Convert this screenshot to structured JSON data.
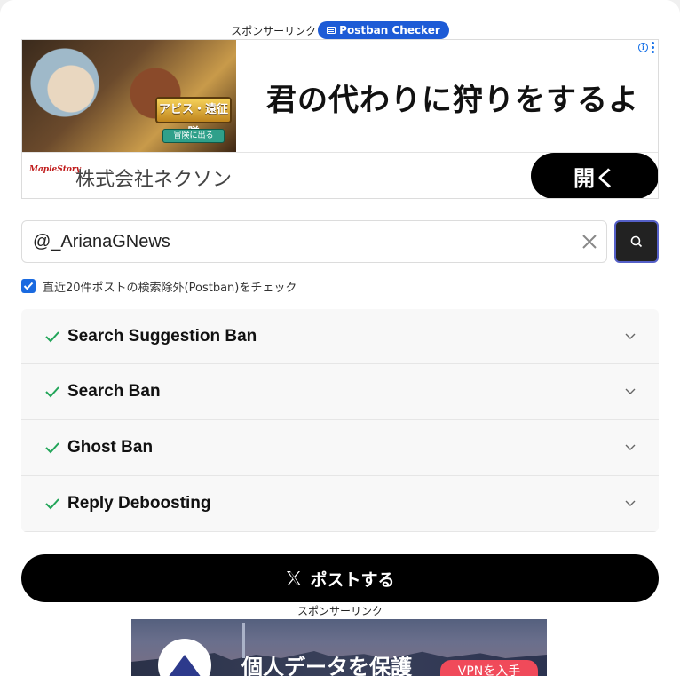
{
  "top_sponsor": {
    "label": "スポンサーリンク",
    "badge": "Postban Checker"
  },
  "ad_top": {
    "headline": "君の代わりに狩りをするよ",
    "game_title": "アビス・遠征隊",
    "game_button": "冒険に出る",
    "brand_logo_text": "MapleStory",
    "company": "株式会社ネクソン",
    "open_label": "開く"
  },
  "search": {
    "value": "@_ArianaGNews",
    "placeholder": ""
  },
  "option": {
    "checked": true,
    "label": "直近20件ポストの検索除外(Postban)をチェック"
  },
  "checks": [
    {
      "title": "Search Suggestion Ban",
      "status": "ok"
    },
    {
      "title": "Search Ban",
      "status": "ok"
    },
    {
      "title": "Ghost Ban",
      "status": "ok"
    },
    {
      "title": "Reply Deboosting",
      "status": "ok"
    }
  ],
  "post_button": {
    "label": "ポストする"
  },
  "bottom_sponsor": {
    "label": "スポンサーリンク"
  },
  "ad_bottom": {
    "headline": "個人データを保護",
    "cta": "VPNを入手"
  },
  "colors": {
    "accent_blue": "#1a6ae0",
    "check_green": "#22a559",
    "primary_button": "#000000",
    "search_button": "#222222"
  }
}
